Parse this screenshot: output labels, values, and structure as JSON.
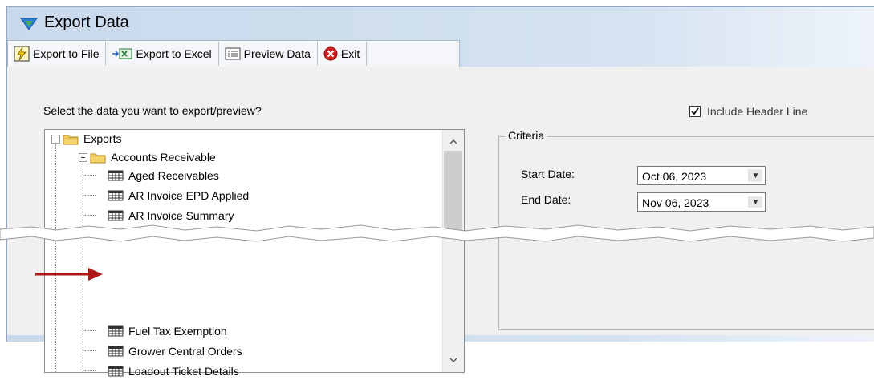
{
  "window": {
    "title": "Export Data"
  },
  "toolbar": {
    "export_file": "Export to File",
    "export_excel": "Export to Excel",
    "preview": "Preview Data",
    "exit": "Exit"
  },
  "prompt": "Select the data you want to export/preview?",
  "include_header": {
    "label": "Include Header Line",
    "checked": true
  },
  "tree": {
    "root": "Exports",
    "folder": "Accounts Receivable",
    "items_top": [
      "Aged Receivables",
      "AR Invoice EPD Applied",
      "AR Invoice Summary"
    ],
    "items_bottom": [
      "Fuel Tax Exemption",
      "Grower Central Orders",
      "Loadout Ticket Details"
    ]
  },
  "criteria": {
    "title": "Criteria",
    "start_label": "Start Date:",
    "start_value": "Oct  06, 2023",
    "end_label": "End Date:",
    "end_value": "Nov 06, 2023"
  },
  "icons": {
    "title": "triangle-logo-icon",
    "export_file": "lightning-icon",
    "export_excel": "excel-icon",
    "preview": "preview-icon",
    "exit": "exit-icon",
    "pointer": "red-arrow-icon"
  },
  "colors": {
    "arrow": "#b01818",
    "exit": "#d42020",
    "logo": "#2a7fd4"
  }
}
